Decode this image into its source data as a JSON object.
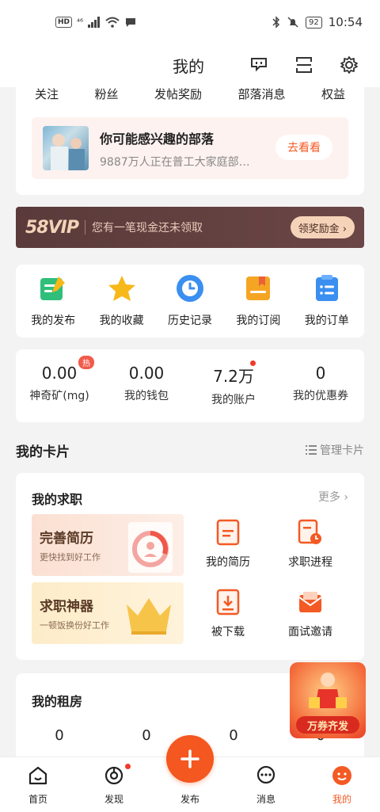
{
  "status_bar": {
    "hd": "HD",
    "signal": "⁴⁶",
    "battery": "92",
    "time": "10:54"
  },
  "header": {
    "title": "我的"
  },
  "follow_stats": [
    "关注",
    "粉丝",
    "发帖奖励",
    "部落消息",
    "权益"
  ],
  "tribe": {
    "title": "你可能感兴趣的部落",
    "subtitle": "9887万人正在普工大家庭部…",
    "button": "去看看"
  },
  "vip": {
    "logo": "58VIP",
    "text": "您有一笔现金还未领取",
    "button": "领奖励金 ›"
  },
  "quick_actions": [
    {
      "label": "我的发布",
      "icon": "edit-icon",
      "color": "#2fbf7a"
    },
    {
      "label": "我的收藏",
      "icon": "star-icon",
      "color": "#f7b819"
    },
    {
      "label": "历史记录",
      "icon": "clock-icon",
      "color": "#3a8ff0"
    },
    {
      "label": "我的订阅",
      "icon": "bookmark-icon",
      "color": "#f5a524"
    },
    {
      "label": "我的订单",
      "icon": "order-list-icon",
      "color": "#3a8ff0"
    }
  ],
  "wallet": [
    {
      "value": "0.00",
      "label": "神奇矿(mg)",
      "badge": "热"
    },
    {
      "value": "0.00",
      "label": "我的钱包"
    },
    {
      "value": "7.2万",
      "label": "我的账户"
    },
    {
      "value": "0",
      "label": "我的优惠券"
    }
  ],
  "cards_section": {
    "title": "我的卡片",
    "manage": "管理卡片"
  },
  "job_card": {
    "title": "我的求职",
    "more": "更多 ›",
    "promo1": {
      "title": "完善简历",
      "subtitle": "更快找到好工作"
    },
    "promo2": {
      "title": "求职神器",
      "subtitle": "一顿饭换份好工作"
    },
    "items": [
      {
        "label": "我的简历",
        "icon": "resume-icon"
      },
      {
        "label": "求职进程",
        "icon": "progress-icon"
      },
      {
        "label": "被下载",
        "icon": "download-icon"
      },
      {
        "label": "面试邀请",
        "icon": "envelope-icon"
      }
    ]
  },
  "rent_card": {
    "title": "我的租房",
    "values": [
      "0",
      "0",
      "0",
      "0"
    ]
  },
  "floating_promo": {
    "label": "万券齐发"
  },
  "tabbar": [
    {
      "label": "首页",
      "icon": "home-icon"
    },
    {
      "label": "发现",
      "icon": "discover-icon"
    },
    {
      "label": "发布",
      "icon": "plus-icon"
    },
    {
      "label": "消息",
      "icon": "message-icon"
    },
    {
      "label": "我的",
      "icon": "profile-icon"
    }
  ],
  "colors": {
    "accent": "#f35a24",
    "vip_bg": "#5a3a3a"
  }
}
